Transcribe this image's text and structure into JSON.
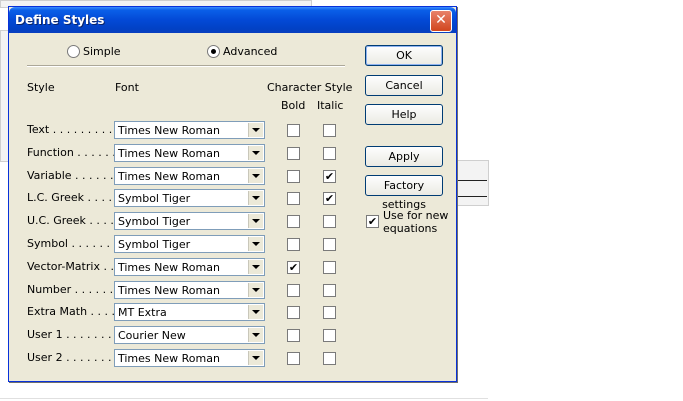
{
  "dialog": {
    "title": "Define Styles",
    "close_glyph": "✕"
  },
  "mode": {
    "simple_label": "Simple",
    "advanced_label": "Advanced",
    "selected": "Advanced"
  },
  "headers": {
    "style": "Style",
    "font": "Font",
    "character_style": "Character Style",
    "bold": "Bold",
    "italic": "Italic"
  },
  "styles": [
    {
      "label": "Text . . . . . . . . . .",
      "font": "Times New Roman",
      "bold": false,
      "italic": false
    },
    {
      "label": "Function . . . . . . .",
      "font": "Times New Roman",
      "bold": false,
      "italic": false
    },
    {
      "label": "Variable . . . . . . .",
      "font": "Times New Roman",
      "bold": false,
      "italic": true
    },
    {
      "label": "L.C. Greek . . . . .",
      "font": "Symbol Tiger",
      "bold": false,
      "italic": true
    },
    {
      "label": "U.C. Greek . . . . .",
      "font": "Symbol Tiger",
      "bold": false,
      "italic": false
    },
    {
      "label": "Symbol . . . . . . . .",
      "font": "Symbol Tiger",
      "bold": false,
      "italic": false
    },
    {
      "label": "Vector-Matrix . . .",
      "font": "Times New Roman",
      "bold": true,
      "italic": false
    },
    {
      "label": "Number . . . . . . .",
      "font": "Times New Roman",
      "bold": false,
      "italic": false
    },
    {
      "label": "Extra Math . . . . .",
      "font": "MT Extra",
      "bold": false,
      "italic": false
    },
    {
      "label": "User 1 . . . . . . .",
      "font": "Courier New",
      "bold": false,
      "italic": false
    },
    {
      "label": "User 2 . . . . . . . .",
      "font": "Times New Roman",
      "bold": false,
      "italic": false
    }
  ],
  "buttons": {
    "ok": "OK",
    "cancel": "Cancel",
    "help": "Help",
    "apply": "Apply",
    "factory": "Factory settings"
  },
  "use_for_new": {
    "label_line1": "Use for new",
    "label_line2": "equations",
    "checked": true
  },
  "colors": {
    "titlebar": "#0349d6",
    "dialog_bg": "#ece9d8",
    "close": "#d1451e"
  }
}
